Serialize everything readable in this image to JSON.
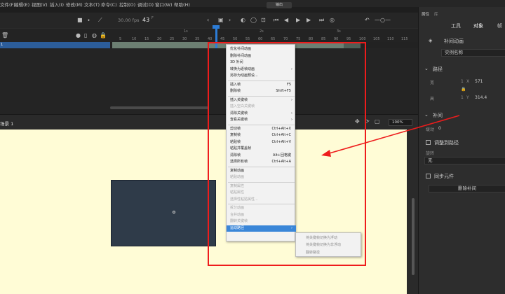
{
  "menubar": {
    "items": [
      "文件(F)",
      "编辑(E)",
      "视图(V)",
      "插入(I)",
      "修改(M)",
      "文本(T)",
      "命令(C)",
      "控制(O)",
      "调试(D)",
      "窗口(W)",
      "帮助(H)"
    ],
    "window_title": "输出"
  },
  "timeline": {
    "fps": "30.00 fps",
    "current_frame": "43",
    "frame_suffix": "F",
    "seconds_markers": [
      "1s",
      "2s",
      "3s"
    ],
    "frame_numbers": [
      "5",
      "10",
      "15",
      "20",
      "25",
      "30",
      "35",
      "40",
      "45",
      "50",
      "55",
      "60",
      "65",
      "70",
      "75",
      "80",
      "85",
      "90",
      "95",
      "100",
      "105",
      "110",
      "115"
    ],
    "layer_name": "1"
  },
  "scene": {
    "label": "场景 1",
    "zoom": "100%"
  },
  "context_menu": {
    "items": [
      {
        "label": "优化补间动画",
        "shortcut": "",
        "submenu": false,
        "disabled": false
      },
      {
        "label": "删除补间动画",
        "shortcut": "",
        "submenu": false,
        "disabled": false
      },
      {
        "label": "3D 补间",
        "shortcut": "",
        "submenu": false,
        "disabled": false
      },
      {
        "label": "转换为逐帧动画",
        "shortcut": "",
        "submenu": true,
        "disabled": false
      },
      {
        "label": "另存为动画预设...",
        "shortcut": "",
        "submenu": false,
        "disabled": false
      },
      {
        "label": "插入帧",
        "shortcut": "F5",
        "submenu": false,
        "disabled": false,
        "sep_before": true
      },
      {
        "label": "删除帧",
        "shortcut": "Shift+F5",
        "submenu": false,
        "disabled": false
      },
      {
        "label": "插入关键帧",
        "shortcut": "",
        "submenu": true,
        "disabled": false,
        "sep_before": true
      },
      {
        "label": "插入空白关键帧",
        "shortcut": "",
        "submenu": false,
        "disabled": true
      },
      {
        "label": "清除关键帧",
        "shortcut": "",
        "submenu": true,
        "disabled": false
      },
      {
        "label": "查看关键帧",
        "shortcut": "",
        "submenu": true,
        "disabled": false
      },
      {
        "label": "剪切帧",
        "shortcut": "Ctrl+Alt+X",
        "submenu": false,
        "disabled": false,
        "sep_before": true
      },
      {
        "label": "复制帧",
        "shortcut": "Ctrl+Alt+C",
        "submenu": false,
        "disabled": false
      },
      {
        "label": "粘贴帧",
        "shortcut": "Ctrl+Alt+V",
        "submenu": false,
        "disabled": false
      },
      {
        "label": "粘贴并覆盖帧",
        "shortcut": "",
        "submenu": false,
        "disabled": false
      },
      {
        "label": "清除帧",
        "shortcut": "Alt+回格键",
        "submenu": false,
        "disabled": false
      },
      {
        "label": "选择所有帧",
        "shortcut": "Ctrl+Alt+A",
        "submenu": false,
        "disabled": false
      },
      {
        "label": "复制动画",
        "shortcut": "",
        "submenu": false,
        "disabled": false,
        "sep_before": true
      },
      {
        "label": "粘贴动画",
        "shortcut": "",
        "submenu": false,
        "disabled": true
      },
      {
        "label": "复制属性",
        "shortcut": "",
        "submenu": false,
        "disabled": true,
        "sep_before": true
      },
      {
        "label": "粘贴属性",
        "shortcut": "",
        "submenu": false,
        "disabled": true
      },
      {
        "label": "选择性粘贴属性...",
        "shortcut": "",
        "submenu": false,
        "disabled": true
      },
      {
        "label": "拆分动画",
        "shortcut": "",
        "submenu": false,
        "disabled": true,
        "sep_before": true
      },
      {
        "label": "合并动画",
        "shortcut": "",
        "submenu": false,
        "disabled": true
      },
      {
        "label": "翻转关键帧",
        "shortcut": "",
        "submenu": false,
        "disabled": true
      },
      {
        "label": "运动路径",
        "shortcut": "",
        "submenu": true,
        "disabled": false,
        "active": true
      }
    ]
  },
  "submenu": {
    "items": [
      "将关键帧切换为浮动",
      "将关键帧切换为非浮动",
      "翻转路径"
    ]
  },
  "properties": {
    "tab": "属性",
    "tab2": "库",
    "subtabs": [
      "工具",
      "对象",
      "帧"
    ],
    "object_type": "补间动画",
    "instance_placeholder": "实例名称",
    "path_section": "路径",
    "x_label": "X",
    "y_label": "Y",
    "w_label": "宽",
    "h_label": "高",
    "w_value": "1",
    "h_value": "1",
    "x_value": "571",
    "y_value": "314.4",
    "tween_section": "补间",
    "ease_label": "缓动",
    "ease_value": "0",
    "orient_label": "调整到路径",
    "rotate_label": "旋转",
    "rotate_value": "无",
    "sync_label": "同步元件",
    "remove_button": "删除补间"
  },
  "annotations": {
    "box_color": "#ee1c1c",
    "arrow_color": "#ee1c1c"
  },
  "colors": {
    "stage": "#fffcd6",
    "selection": "#3a86d8",
    "tween": "#6c7f72",
    "playhead": "#2c7cd6"
  }
}
